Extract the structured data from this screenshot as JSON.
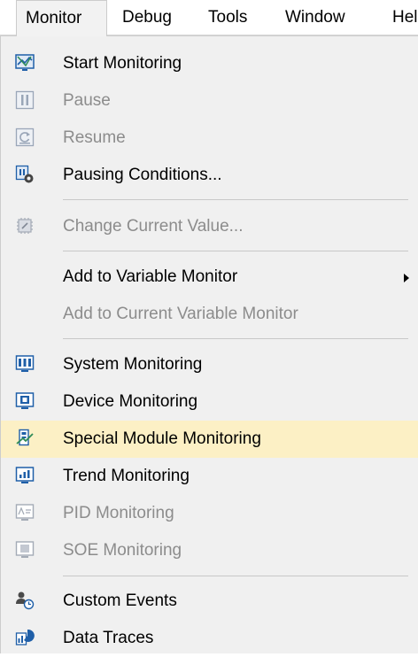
{
  "menubar": {
    "items": [
      {
        "label": "Monitor"
      },
      {
        "label": "Debug"
      },
      {
        "label": "Tools"
      },
      {
        "label": "Window"
      },
      {
        "label": "Hel"
      }
    ]
  },
  "dropdown": {
    "items": [
      {
        "label": "Start Monitoring",
        "icon": "monitor-start-icon",
        "enabled": true
      },
      {
        "label": "Pause",
        "icon": "pause-icon",
        "enabled": false
      },
      {
        "label": "Resume",
        "icon": "resume-icon",
        "enabled": false
      },
      {
        "label": "Pausing Conditions...",
        "icon": "pausing-conditions-icon",
        "enabled": true
      },
      {
        "label": "Change Current Value...",
        "icon": "change-value-icon",
        "enabled": false
      },
      {
        "label": "Add to Variable Monitor",
        "icon": "",
        "enabled": true,
        "submenu": true
      },
      {
        "label": "Add to Current Variable Monitor",
        "icon": "",
        "enabled": false
      },
      {
        "label": "System Monitoring",
        "icon": "system-monitoring-icon",
        "enabled": true
      },
      {
        "label": "Device Monitoring",
        "icon": "device-monitoring-icon",
        "enabled": true
      },
      {
        "label": "Special Module Monitoring",
        "icon": "special-module-icon",
        "enabled": true,
        "highlighted": true
      },
      {
        "label": "Trend Monitoring",
        "icon": "trend-monitoring-icon",
        "enabled": true
      },
      {
        "label": "PID Monitoring",
        "icon": "pid-monitoring-icon",
        "enabled": false
      },
      {
        "label": "SOE Monitoring",
        "icon": "soe-monitoring-icon",
        "enabled": false
      },
      {
        "label": "Custom Events",
        "icon": "custom-events-icon",
        "enabled": true
      },
      {
        "label": "Data Traces",
        "icon": "data-traces-icon",
        "enabled": true
      }
    ]
  },
  "colors": {
    "highlight": "#fcf0c5",
    "disabled_text": "#8c8c8c",
    "menu_bg": "#f0f0f0",
    "accent_blue": "#1f5fa8"
  }
}
